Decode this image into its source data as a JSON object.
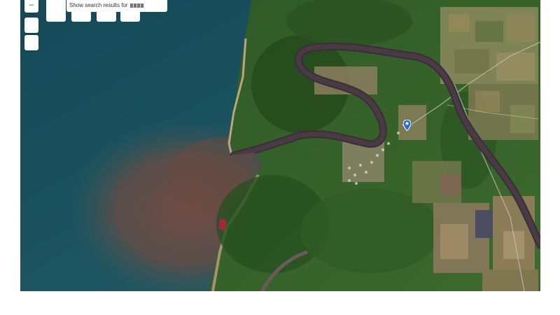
{
  "map": {
    "view": "satellite",
    "marker_color": "#2b6fd6"
  },
  "controls": {
    "zoom_out_label": "–"
  },
  "search_banner": {
    "text": "Show search results for"
  },
  "icons": {
    "pin": "map-pin-icon"
  }
}
